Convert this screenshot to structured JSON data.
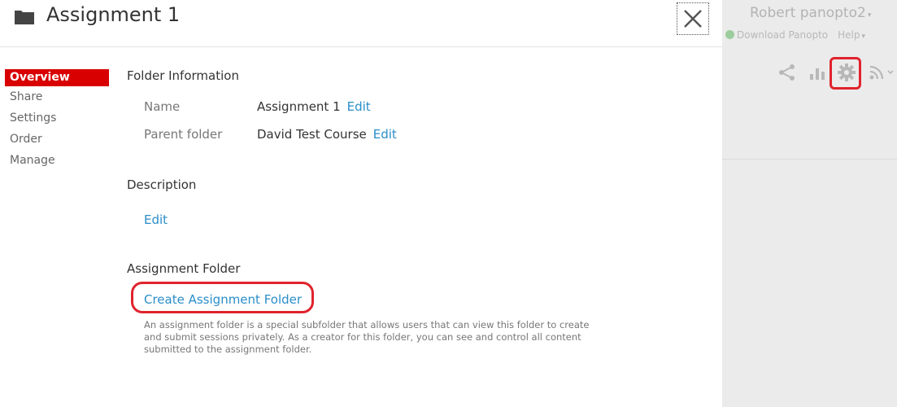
{
  "dialog": {
    "title": "Assignment 1",
    "close_label": "✕"
  },
  "nav": {
    "items": [
      {
        "label": "Overview",
        "active": true
      },
      {
        "label": "Share",
        "active": false
      },
      {
        "label": "Settings",
        "active": false
      },
      {
        "label": "Order",
        "active": false
      },
      {
        "label": "Manage",
        "active": false
      }
    ]
  },
  "folder_info": {
    "title": "Folder Information",
    "name_label": "Name",
    "name_value": "Assignment 1",
    "parent_label": "Parent folder",
    "parent_value": "David Test Course",
    "edit_label": "Edit"
  },
  "description": {
    "title": "Description",
    "edit_label": "Edit"
  },
  "assignment_folder": {
    "title": "Assignment Folder",
    "create_label": "Create Assignment Folder",
    "help_text": "An assignment folder is a special subfolder that allows users that can view this folder to create and submit sessions privately. As a creator for this folder, you can see and control all content submitted to the assignment folder."
  },
  "background": {
    "user_name": "Robert panopto2",
    "download_label": "Download Panopto",
    "help_label": "Help",
    "toolbar_icons": [
      "share-icon",
      "stats-icon",
      "gear-icon",
      "rss-icon"
    ]
  },
  "colors": {
    "accent_red": "#d80000",
    "highlight_red": "#e0232d",
    "link_blue": "#2a8ec9"
  }
}
